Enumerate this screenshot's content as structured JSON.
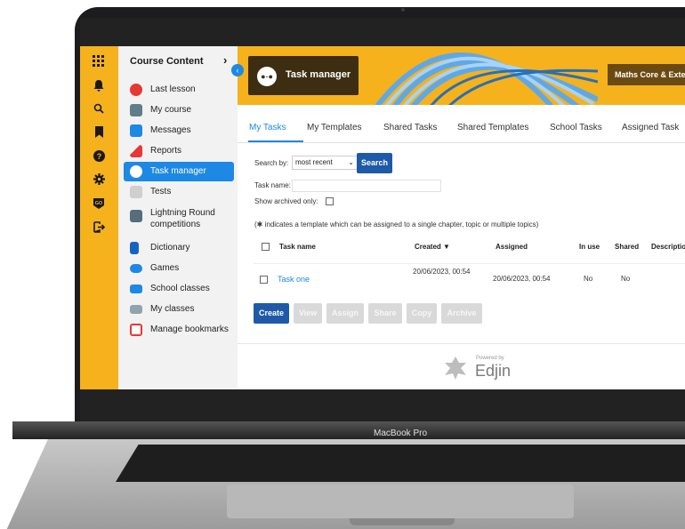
{
  "device": {
    "label": "MacBook Pro"
  },
  "sidebar": {
    "title": "Course Content",
    "items": [
      {
        "label": "Last lesson",
        "icon": "last-lesson-icon",
        "color": "#e53935"
      },
      {
        "label": "My course",
        "icon": "course-icon",
        "color": "#607d8b"
      },
      {
        "label": "Messages",
        "icon": "messages-icon",
        "color": "#1e88e5"
      },
      {
        "label": "Reports",
        "icon": "reports-icon",
        "color": "#e53935"
      },
      {
        "label": "Task manager",
        "icon": "task-manager-icon",
        "color": "#ffffff"
      },
      {
        "label": "Tests",
        "icon": "tests-icon",
        "color": "#bdbdbd"
      },
      {
        "label": "Lightning Round competitions",
        "icon": "lightning-round-icon",
        "color": "#546e7a"
      },
      {
        "label": "Dictionary",
        "icon": "dictionary-icon",
        "color": "#1565c0"
      },
      {
        "label": "Games",
        "icon": "games-icon",
        "color": "#1e88e5"
      },
      {
        "label": "School classes",
        "icon": "school-classes-icon",
        "color": "#1e88e5"
      },
      {
        "label": "My classes",
        "icon": "my-classes-icon",
        "color": "#90a4ae"
      },
      {
        "label": "Manage bookmarks",
        "icon": "bookmarks-icon",
        "color": "#e53935"
      }
    ]
  },
  "iconbar": {
    "icons": [
      "apps-grid-icon",
      "bell-icon",
      "search-icon",
      "bookmark-icon",
      "help-icon",
      "gear-icon",
      "go-icon",
      "logout-icon"
    ]
  },
  "banner": {
    "title": "Task manager",
    "course_button": "Maths Core & Exte"
  },
  "tabs": [
    "My Tasks",
    "My Templates",
    "Shared Tasks",
    "Shared Templates",
    "School Tasks",
    "Assigned Task"
  ],
  "filters": {
    "search_by_label": "Search by:",
    "search_by_value": "most recent",
    "search_button": "Search",
    "task_name_label": "Task name:",
    "archived_label": "Show archived only:"
  },
  "note": "(✱ indicates a template which can be assigned to a single chapter, topic or multiple topics)",
  "table": {
    "headers": [
      "Task name",
      "Created ▼",
      "Assigned",
      "In use",
      "Shared",
      "Description"
    ],
    "rows": [
      {
        "name": "Task one",
        "created": "20/06/2023, 00:54",
        "assigned": "20/06/2023, 00:54",
        "in_use": "No",
        "shared": "No"
      }
    ]
  },
  "actions": [
    "Create",
    "View",
    "Assign",
    "Share",
    "Copy",
    "Archive"
  ],
  "footer": {
    "powered_by": "Powered by",
    "brand": "Edjin"
  },
  "colors": {
    "accent": "#f5b21c",
    "primary": "#1e5aa8",
    "link": "#1e88e5"
  }
}
